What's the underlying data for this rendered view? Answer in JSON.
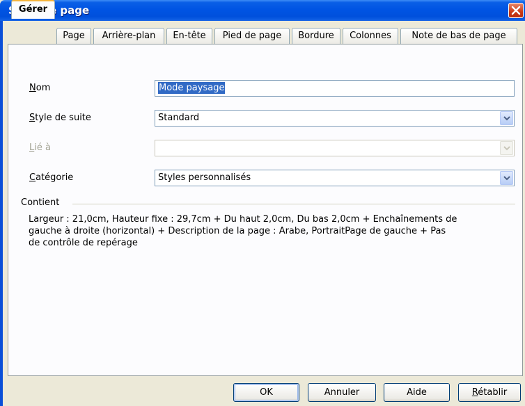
{
  "window": {
    "title": "Style de page"
  },
  "tabs": [
    {
      "label": "Gérer",
      "active": true
    },
    {
      "label": "Page"
    },
    {
      "label": "Arrière-plan"
    },
    {
      "label": "En-tête"
    },
    {
      "label": "Pied de page"
    },
    {
      "label": "Bordure"
    },
    {
      "label": "Colonnes"
    },
    {
      "label": "Note de bas de page"
    }
  ],
  "form": {
    "name": {
      "label_first": "N",
      "label_rest": "om",
      "value": "Mode paysage"
    },
    "next_style": {
      "label_first": "S",
      "label_rest": "tyle de suite",
      "value": "Standard"
    },
    "linked_to": {
      "label_first": "L",
      "label_rest": "ié à",
      "value": ""
    },
    "category": {
      "label_first": "C",
      "label_rest": "atégorie",
      "value": "Styles personnalisés"
    }
  },
  "contains": {
    "label": "Contient",
    "lines": [
      "Largeur : 21,0cm, Hauteur fixe : 29,7cm + Du haut 2,0cm, Du bas 2,0cm + Enchaînements de",
      "gauche à droite (horizontal) + Description de la page : Arabe, PortraitPage de gauche + Pas",
      "de contrôle de repérage"
    ]
  },
  "buttons": {
    "ok": "OK",
    "cancel": "Annuler",
    "help": "Aide",
    "reset_first": "R",
    "reset_rest": "établir"
  },
  "colors": {
    "titlebar": "#0054e3",
    "dialog_bg": "#ece9d8",
    "selection": "#316ac5",
    "close": "#cc3a16"
  }
}
